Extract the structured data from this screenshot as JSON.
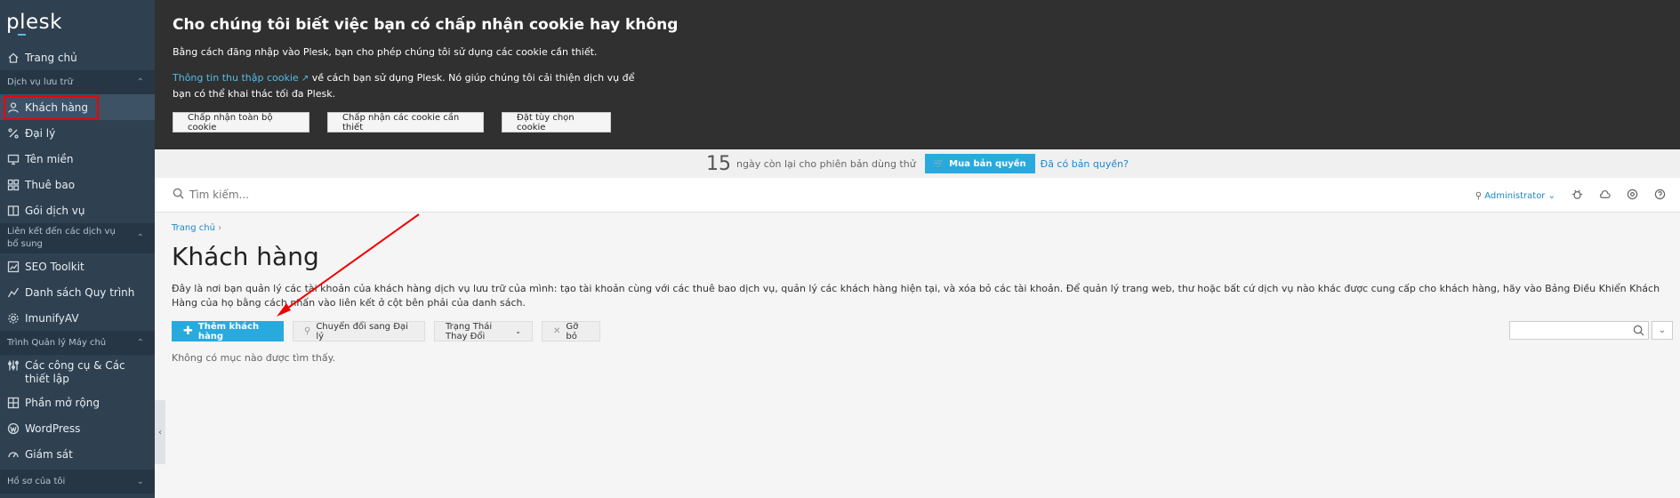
{
  "app": {
    "logo": "plesk"
  },
  "sidebar": {
    "home": "Trang chủ",
    "section_hosting": "Dịch vụ lưu trữ",
    "customers": "Khách hàng",
    "resellers": "Đại lý",
    "domains": "Tên miền",
    "subscriptions": "Thuê bao",
    "service_plans": "Gói dịch vụ",
    "section_links": "Liên kết đến các dịch vụ bổ sung",
    "seo_toolkit": "SEO Toolkit",
    "process_list": "Danh sách Quy trình",
    "imunifyav": "ImunifyAV",
    "section_server": "Trình Quản lý Máy chủ",
    "tools_settings": "Các công cụ & Các thiết lập",
    "extensions": "Phần mở rộng",
    "wordpress": "WordPress",
    "monitoring": "Giám sát",
    "section_profile": "Hồ sơ của tôi"
  },
  "cookie": {
    "title": "Cho chúng tôi biết việc bạn có chấp nhận cookie hay không",
    "text1": "Bằng cách đăng nhập vào Plesk, bạn cho phép chúng tôi sử dụng các cookie cần thiết.",
    "link": "Thông tin thu thập cookie",
    "text2": "về cách bạn sử dụng Plesk. Nó giúp chúng tôi cải thiện dịch vụ để bạn có thể khai thác tối đa Plesk.",
    "accept_all": "Chấp nhận toàn bộ cookie",
    "accept_required": "Chấp nhận các cookie cần thiết",
    "custom": "Đặt tùy chọn cookie"
  },
  "trial": {
    "days": "15",
    "text": "ngày còn lại cho phiên bản dùng thử",
    "buy": "Mua bản quyền",
    "have_license": "Đã có bản quyền?"
  },
  "topbar": {
    "search_placeholder": "Tìm kiếm...",
    "user": "Administrator"
  },
  "main": {
    "breadcrumb": "Trang chủ",
    "title": "Khách hàng",
    "description": "Đây là nơi bạn quản lý các tài khoản của khách hàng dịch vụ lưu trữ của mình: tạo tài khoản cùng với các thuê bao dịch vụ, quản lý các khách hàng hiện tại, và xóa bỏ các tài khoản. Để quản lý trang web, thư hoặc bất cứ dịch vụ nào khác được cung cấp cho khách hàng, hãy vào Bảng Điều Khiển Khách Hàng của họ bằng cách nhấn vào liên kết ở cột bên phải của danh sách.",
    "add_customer": "Thêm khách hàng",
    "convert_reseller": "Chuyển đổi sang Đại lý",
    "change_status": "Trạng Thái Thay Đổi",
    "remove": "Gỡ bỏ",
    "empty": "Không có mục nào được tìm thấy."
  },
  "colors": {
    "sidebar": "#2f4050",
    "accent": "#28aade",
    "banner": "#303030",
    "annotation": "#ee0000"
  }
}
